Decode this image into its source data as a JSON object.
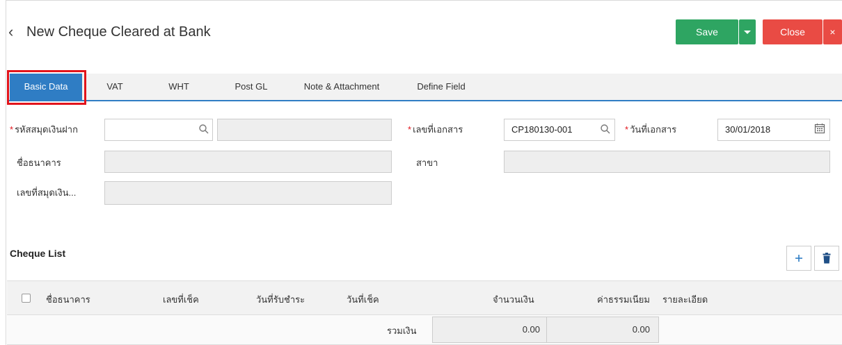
{
  "header": {
    "back_icon": "chevron-left-icon",
    "title": "New Cheque Cleared at Bank",
    "save_label": "Save",
    "close_label": "Close",
    "close_x": "×"
  },
  "tabs": [
    {
      "label": "Basic Data",
      "active": true
    },
    {
      "label": "VAT"
    },
    {
      "label": "WHT"
    },
    {
      "label": "Post GL"
    },
    {
      "label": "Note & Attachment"
    },
    {
      "label": "Define Field"
    }
  ],
  "form": {
    "bank_book_code": {
      "label": "รหัสสมุดเงินฝาก",
      "required": true,
      "value": "",
      "name_value": ""
    },
    "bank_name": {
      "label": "ชื่อธนาคาร",
      "value": ""
    },
    "account_no": {
      "label": "เลขที่สมุดเงิน...",
      "value": ""
    },
    "doc_no": {
      "label": "เลขที่เอกสาร",
      "required": true,
      "value": "CP180130-001"
    },
    "doc_date": {
      "label": "วันที่เอกสาร",
      "required": true,
      "value": "30/01/2018"
    },
    "branch": {
      "label": "สาขา",
      "value": ""
    }
  },
  "cheque_list": {
    "title": "Cheque List",
    "columns": [
      "ชื่อธนาคาร",
      "เลขที่เช็ค",
      "วันที่รับชำระ",
      "วันที่เช็ค",
      "จำนวนเงิน",
      "ค่าธรรมเนียม",
      "รายละเอียด"
    ],
    "total_label": "รวมเงิน",
    "total_amount": "0.00",
    "total_fee": "0.00"
  },
  "colors": {
    "save": "#2ea562",
    "close": "#e94b44",
    "tab_active": "#2f7dc4",
    "highlight": "#e2141b"
  }
}
